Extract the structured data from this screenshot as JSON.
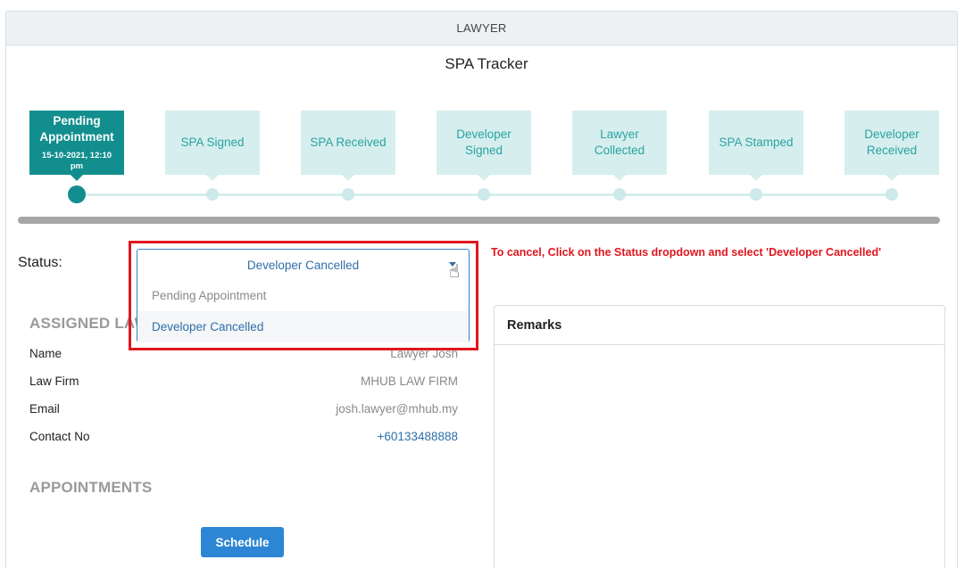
{
  "header": {
    "title": "LAWYER"
  },
  "tracker": {
    "title": "SPA Tracker",
    "steps": [
      {
        "label": "Pending Appointment",
        "date": "15-10-2021, 12:10 pm"
      },
      {
        "label": "SPA Signed"
      },
      {
        "label": "SPA Received"
      },
      {
        "label": "Developer Signed"
      },
      {
        "label": "Lawyer Collected"
      },
      {
        "label": "SPA Stamped"
      },
      {
        "label": "Developer Received"
      }
    ]
  },
  "status": {
    "label": "Status:",
    "selected": "Developer Cancelled",
    "options": [
      "Pending Appointment",
      "Developer Cancelled"
    ],
    "note": "To cancel, Click on the Status dropdown and select 'Developer Cancelled'"
  },
  "lawyer": {
    "section_title": "ASSIGNED LAWYER",
    "name_label": "Name",
    "name_value": "Lawyer Josh",
    "firm_label": "Law Firm",
    "firm_value": "MHUB LAW FIRM",
    "email_label": "Email",
    "email_value": "josh.lawyer@mhub.my",
    "contact_label": "Contact No",
    "contact_value": "+60133488888"
  },
  "appointments": {
    "section_title": "APPOINTMENTS",
    "schedule_label": "Schedule"
  },
  "remarks": {
    "title": "Remarks"
  },
  "colors": {
    "accent": "#128e8e",
    "step_inactive": "#d6eeee",
    "highlight": "#e0161e",
    "link": "#2f6faa"
  },
  "icons": {
    "cursor": "hand-pointer-icon",
    "dropdown": "caret-down-icon"
  }
}
